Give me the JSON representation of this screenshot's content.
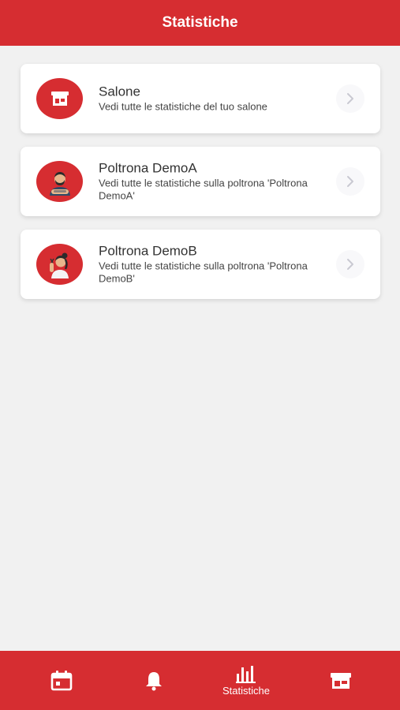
{
  "header": {
    "title": "Statistiche"
  },
  "cards": [
    {
      "title": "Salone",
      "subtitle": "Vedi tutte le statistiche del tuo salone",
      "icon": "store-icon"
    },
    {
      "title": "Poltrona DemoA",
      "subtitle": "Vedi tutte le statistiche sulla poltrona 'Poltrona DemoA'",
      "icon": "barber-man-avatar"
    },
    {
      "title": "Poltrona DemoB",
      "subtitle": "Vedi tutte le statistiche sulla poltrona 'Poltrona DemoB'",
      "icon": "barber-woman-avatar"
    }
  ],
  "tabbar": {
    "tabs": [
      {
        "icon": "calendar-icon",
        "label": ""
      },
      {
        "icon": "bell-icon",
        "label": ""
      },
      {
        "icon": "bar-chart-icon",
        "label": "Statistiche",
        "active": true
      },
      {
        "icon": "store-icon",
        "label": ""
      }
    ]
  },
  "colors": {
    "brand_red": "#d62d31",
    "background": "#f1f1f1",
    "card": "#ffffff"
  }
}
